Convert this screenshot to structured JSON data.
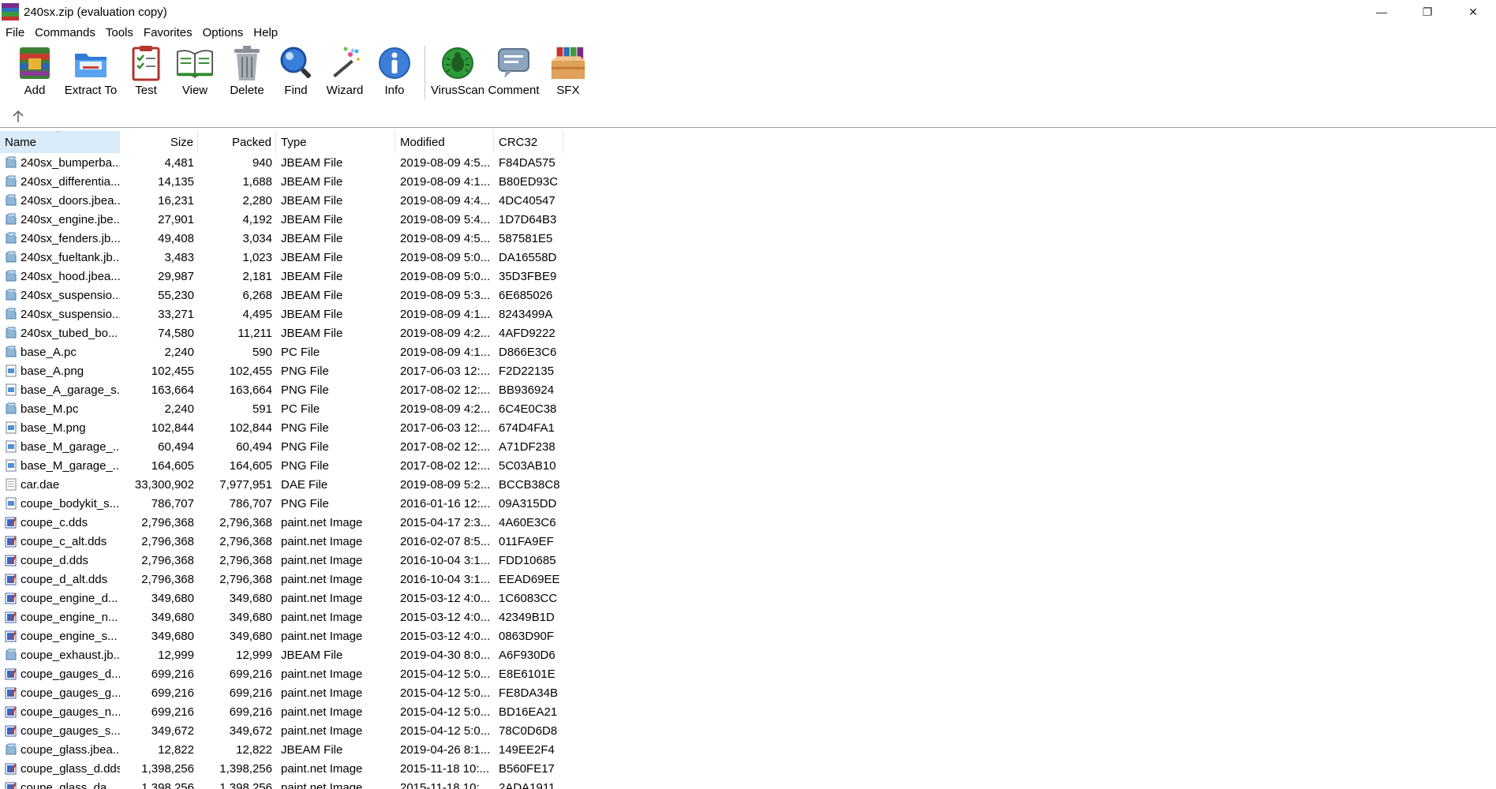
{
  "window": {
    "title": "240sx.zip (evaluation copy)",
    "controls": {
      "minimize": "—",
      "restore": "❐",
      "close": "✕"
    }
  },
  "menu": [
    "File",
    "Commands",
    "Tools",
    "Favorites",
    "Options",
    "Help"
  ],
  "toolbar": [
    {
      "id": "add",
      "label": "Add",
      "icon": "add-icon"
    },
    {
      "id": "extract",
      "label": "Extract To",
      "icon": "extract-to-icon"
    },
    {
      "id": "test",
      "label": "Test",
      "icon": "test-icon"
    },
    {
      "id": "view",
      "label": "View",
      "icon": "view-icon"
    },
    {
      "id": "delete",
      "label": "Delete",
      "icon": "delete-icon"
    },
    {
      "id": "find",
      "label": "Find",
      "icon": "find-icon"
    },
    {
      "id": "wizard",
      "label": "Wizard",
      "icon": "wizard-icon"
    },
    {
      "id": "info",
      "label": "Info",
      "icon": "info-icon"
    },
    {
      "id": "virusscan",
      "label": "VirusScan",
      "icon": "virus-scan-icon"
    },
    {
      "id": "comment",
      "label": "Comment",
      "icon": "comment-icon"
    },
    {
      "id": "sfx",
      "label": "SFX",
      "icon": "sfx-icon"
    }
  ],
  "address": {
    "up_icon": "up-arrow-icon"
  },
  "columns": {
    "name": "Name",
    "size": "Size",
    "packed": "Packed",
    "type": "Type",
    "modified": "Modified",
    "crc": "CRC32"
  },
  "files": [
    {
      "name": "240sx_bumperba...",
      "size": "4,481",
      "packed": "940",
      "type": "JBEAM File",
      "modified": "2019-08-09 4:5...",
      "crc": "F84DA575",
      "kind": "file"
    },
    {
      "name": "240sx_differentia...",
      "size": "14,135",
      "packed": "1,688",
      "type": "JBEAM File",
      "modified": "2019-08-09 4:1...",
      "crc": "B80ED93C",
      "kind": "file"
    },
    {
      "name": "240sx_doors.jbea...",
      "size": "16,231",
      "packed": "2,280",
      "type": "JBEAM File",
      "modified": "2019-08-09 4:4...",
      "crc": "4DC40547",
      "kind": "file"
    },
    {
      "name": "240sx_engine.jbe...",
      "size": "27,901",
      "packed": "4,192",
      "type": "JBEAM File",
      "modified": "2019-08-09 5:4...",
      "crc": "1D7D64B3",
      "kind": "file"
    },
    {
      "name": "240sx_fenders.jb...",
      "size": "49,408",
      "packed": "3,034",
      "type": "JBEAM File",
      "modified": "2019-08-09 4:5...",
      "crc": "587581E5",
      "kind": "file"
    },
    {
      "name": "240sx_fueltank.jb...",
      "size": "3,483",
      "packed": "1,023",
      "type": "JBEAM File",
      "modified": "2019-08-09 5:0...",
      "crc": "DA16558D",
      "kind": "file"
    },
    {
      "name": "240sx_hood.jbea...",
      "size": "29,987",
      "packed": "2,181",
      "type": "JBEAM File",
      "modified": "2019-08-09 5:0...",
      "crc": "35D3FBE9",
      "kind": "file"
    },
    {
      "name": "240sx_suspensio...",
      "size": "55,230",
      "packed": "6,268",
      "type": "JBEAM File",
      "modified": "2019-08-09 5:3...",
      "crc": "6E685026",
      "kind": "file"
    },
    {
      "name": "240sx_suspensio...",
      "size": "33,271",
      "packed": "4,495",
      "type": "JBEAM File",
      "modified": "2019-08-09 4:1...",
      "crc": "8243499A",
      "kind": "file"
    },
    {
      "name": "240sx_tubed_bo...",
      "size": "74,580",
      "packed": "11,211",
      "type": "JBEAM File",
      "modified": "2019-08-09 4:2...",
      "crc": "4AFD9222",
      "kind": "file"
    },
    {
      "name": "base_A.pc",
      "size": "2,240",
      "packed": "590",
      "type": "PC File",
      "modified": "2019-08-09 4:1...",
      "crc": "D866E3C6",
      "kind": "file"
    },
    {
      "name": "base_A.png",
      "size": "102,455",
      "packed": "102,455",
      "type": "PNG File",
      "modified": "2017-06-03 12:...",
      "crc": "F2D22135",
      "kind": "png"
    },
    {
      "name": "base_A_garage_s...",
      "size": "163,664",
      "packed": "163,664",
      "type": "PNG File",
      "modified": "2017-08-02 12:...",
      "crc": "BB936924",
      "kind": "png"
    },
    {
      "name": "base_M.pc",
      "size": "2,240",
      "packed": "591",
      "type": "PC File",
      "modified": "2019-08-09 4:2...",
      "crc": "6C4E0C38",
      "kind": "file"
    },
    {
      "name": "base_M.png",
      "size": "102,844",
      "packed": "102,844",
      "type": "PNG File",
      "modified": "2017-06-03 12:...",
      "crc": "674D4FA1",
      "kind": "png"
    },
    {
      "name": "base_M_garage_...",
      "size": "60,494",
      "packed": "60,494",
      "type": "PNG File",
      "modified": "2017-08-02 12:...",
      "crc": "A71DF238",
      "kind": "png"
    },
    {
      "name": "base_M_garage_...",
      "size": "164,605",
      "packed": "164,605",
      "type": "PNG File",
      "modified": "2017-08-02 12:...",
      "crc": "5C03AB10",
      "kind": "png"
    },
    {
      "name": "car.dae",
      "size": "33,300,902",
      "packed": "7,977,951",
      "type": "DAE File",
      "modified": "2019-08-09 5:2...",
      "crc": "BCCB38C8",
      "kind": "doc"
    },
    {
      "name": "coupe_bodykit_s...",
      "size": "786,707",
      "packed": "786,707",
      "type": "PNG File",
      "modified": "2016-01-16 12:...",
      "crc": "09A315DD",
      "kind": "png"
    },
    {
      "name": "coupe_c.dds",
      "size": "2,796,368",
      "packed": "2,796,368",
      "type": "paint.net Image",
      "modified": "2015-04-17 2:3...",
      "crc": "4A60E3C6",
      "kind": "paint"
    },
    {
      "name": "coupe_c_alt.dds",
      "size": "2,796,368",
      "packed": "2,796,368",
      "type": "paint.net Image",
      "modified": "2016-02-07 8:5...",
      "crc": "011FA9EF",
      "kind": "paint"
    },
    {
      "name": "coupe_d.dds",
      "size": "2,796,368",
      "packed": "2,796,368",
      "type": "paint.net Image",
      "modified": "2016-10-04 3:1...",
      "crc": "FDD10685",
      "kind": "paint"
    },
    {
      "name": "coupe_d_alt.dds",
      "size": "2,796,368",
      "packed": "2,796,368",
      "type": "paint.net Image",
      "modified": "2016-10-04 3:1...",
      "crc": "EEAD69EE",
      "kind": "paint"
    },
    {
      "name": "coupe_engine_d...",
      "size": "349,680",
      "packed": "349,680",
      "type": "paint.net Image",
      "modified": "2015-03-12 4:0...",
      "crc": "1C6083CC",
      "kind": "paint"
    },
    {
      "name": "coupe_engine_n...",
      "size": "349,680",
      "packed": "349,680",
      "type": "paint.net Image",
      "modified": "2015-03-12 4:0...",
      "crc": "42349B1D",
      "kind": "paint"
    },
    {
      "name": "coupe_engine_s...",
      "size": "349,680",
      "packed": "349,680",
      "type": "paint.net Image",
      "modified": "2015-03-12 4:0...",
      "crc": "0863D90F",
      "kind": "paint"
    },
    {
      "name": "coupe_exhaust.jb...",
      "size": "12,999",
      "packed": "12,999",
      "type": "JBEAM File",
      "modified": "2019-04-30 8:0...",
      "crc": "A6F930D6",
      "kind": "file"
    },
    {
      "name": "coupe_gauges_d...",
      "size": "699,216",
      "packed": "699,216",
      "type": "paint.net Image",
      "modified": "2015-04-12 5:0...",
      "crc": "E8E6101E",
      "kind": "paint"
    },
    {
      "name": "coupe_gauges_g...",
      "size": "699,216",
      "packed": "699,216",
      "type": "paint.net Image",
      "modified": "2015-04-12 5:0...",
      "crc": "FE8DA34B",
      "kind": "paint"
    },
    {
      "name": "coupe_gauges_n...",
      "size": "699,216",
      "packed": "699,216",
      "type": "paint.net Image",
      "modified": "2015-04-12 5:0...",
      "crc": "BD16EA21",
      "kind": "paint"
    },
    {
      "name": "coupe_gauges_s...",
      "size": "349,672",
      "packed": "349,672",
      "type": "paint.net Image",
      "modified": "2015-04-12 5:0...",
      "crc": "78C0D6D8",
      "kind": "paint"
    },
    {
      "name": "coupe_glass.jbea...",
      "size": "12,822",
      "packed": "12,822",
      "type": "JBEAM File",
      "modified": "2019-04-26 8:1...",
      "crc": "149EE2F4",
      "kind": "file"
    },
    {
      "name": "coupe_glass_d.dds",
      "size": "1,398,256",
      "packed": "1,398,256",
      "type": "paint.net Image",
      "modified": "2015-11-18 10:...",
      "crc": "B560FE17",
      "kind": "paint"
    },
    {
      "name": "coupe_glass_da...",
      "size": "1,398,256",
      "packed": "1,398,256",
      "type": "paint.net Image",
      "modified": "2015-11-18 10:...",
      "crc": "2ADA1911",
      "kind": "paint"
    }
  ],
  "colors": {
    "header_highlight": "#d9ebf9",
    "separator": "#9a9a9a"
  }
}
